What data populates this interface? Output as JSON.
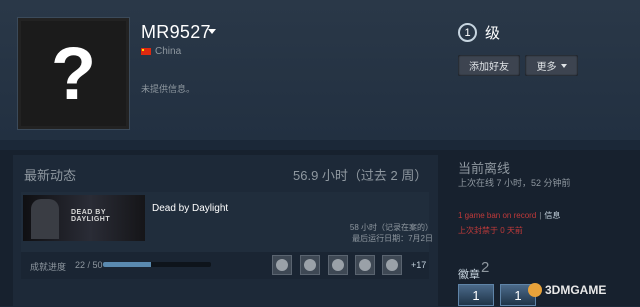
{
  "profile": {
    "persona_name": "MR9527",
    "country": "China",
    "summary": "未提供信息。",
    "avatar_placeholder": "?",
    "level": "1",
    "level_label": "级",
    "add_friend_label": "添加好友",
    "more_label": "更多"
  },
  "recent_activity": {
    "heading": "最新动态",
    "hours_summary": "56.9 小时（过去 2 周）",
    "game": {
      "name": "Dead by Daylight",
      "thumb_title": "DEAD BY DAYLIGHT",
      "hours_on_record": "58 小时（记录在案的）",
      "last_played": "最后运行日期：7月2日"
    },
    "achievements": {
      "label": "成就进度",
      "count": "22 / 50",
      "progress_fraction": 0.44,
      "more": "+17"
    }
  },
  "status": {
    "heading": "当前离线",
    "last_online": "上次在线 7 小时，52 分钟前",
    "ban_text": "1 game ban on record",
    "ban_separator": "|",
    "ban_info": "信息",
    "ban_last": "上次封禁于 0 天前"
  },
  "badges": {
    "label": "徽章",
    "count": "2",
    "tiles": [
      "1",
      "1"
    ]
  },
  "watermark": {
    "text": "3DMGAME"
  },
  "colors": {
    "background": "#1b2838",
    "ban_red": "#c03a3a",
    "progress_blue": "#5a8ab0"
  }
}
